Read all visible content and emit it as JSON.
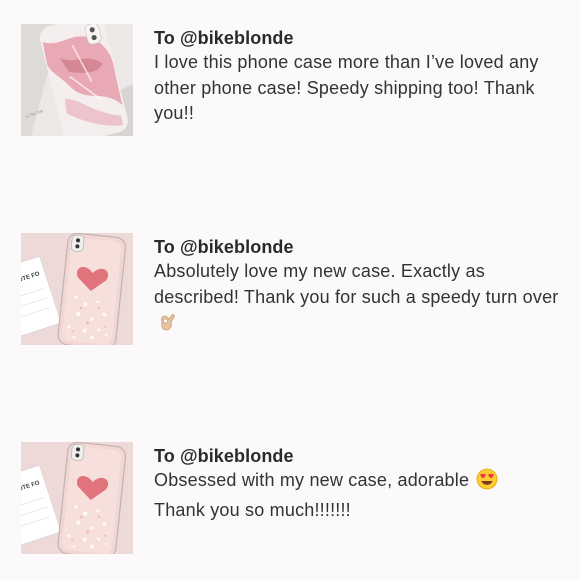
{
  "reviews": [
    {
      "image": "pink-marble-phone-case-photo",
      "author": "To @bikeblonde",
      "text": "I love this phone case more than I’ve loved any other phone case! Speedy shipping too! Thank you!!",
      "emoji": ""
    },
    {
      "image": "glitter-heart-phone-case-photo",
      "author": "To @bikeblonde",
      "text": "Absolutely love my new case. Exactly as described! Thank you for such a speedy turn over",
      "emoji": "ok-hand-emoji"
    },
    {
      "image": "glitter-heart-phone-case-photo",
      "author": "To @bikeblonde",
      "text": "Obsessed with my new case, adorable",
      "text_line2": "Thank you so much!!!!!!!",
      "emoji": "heart-eyes-emoji"
    }
  ]
}
